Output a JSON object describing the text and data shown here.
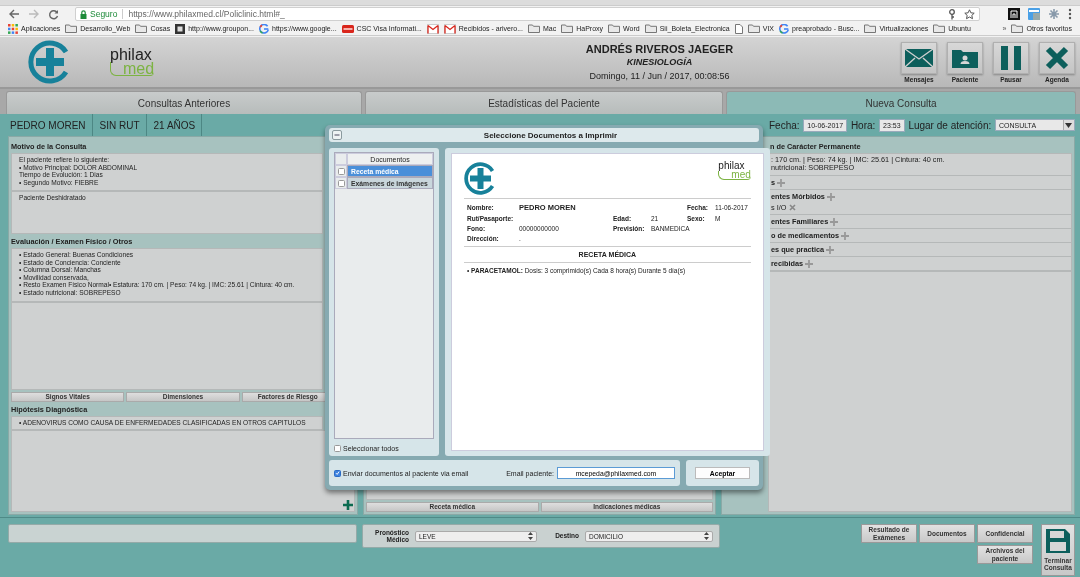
{
  "browser": {
    "secure_label": "Seguro",
    "url": "https://www.philaxmed.cl/Policlinic.html#_",
    "bookmarks": [
      {
        "kind": "apps",
        "label": "Aplicaciones"
      },
      {
        "kind": "folder",
        "label": "Desarrollo_Web"
      },
      {
        "kind": "folder",
        "label": "Cosas"
      },
      {
        "kind": "site",
        "label": "http://www.groupon..."
      },
      {
        "kind": "google",
        "label": "https://www.google..."
      },
      {
        "kind": "card",
        "label": "CSC Visa Informati..."
      },
      {
        "kind": "mail"
      },
      {
        "kind": "mail",
        "label": "Recibidos - arivero..."
      },
      {
        "kind": "folder",
        "label": "Mac"
      },
      {
        "kind": "folder",
        "label": "HaProxy"
      },
      {
        "kind": "folder",
        "label": "Word"
      },
      {
        "kind": "folder",
        "label": "Sii_Boleta_Electronica"
      },
      {
        "kind": "page"
      },
      {
        "kind": "folder",
        "label": "VIX"
      },
      {
        "kind": "google",
        "label": "preaprobado - Busc..."
      },
      {
        "kind": "folder",
        "label": "Virtualizaciones"
      },
      {
        "kind": "folder",
        "label": "Ubuntu"
      }
    ],
    "overflow": "»",
    "other": {
      "kind": "folder",
      "label": "Otros favoritos"
    }
  },
  "header": {
    "logo": {
      "word": "philax",
      "sub": "med"
    },
    "doctor": "ANDRÉS RIVEROS JAEGER",
    "specialty": "KINESIOLOGÍA",
    "datetime": "Domingo, 11 / Jun / 2017, 00:08:56",
    "buttons": [
      {
        "kind": "envelope",
        "label": "Mensajes"
      },
      {
        "kind": "folder-person",
        "label": "Paciente"
      },
      {
        "kind": "pause",
        "label": "Pausar"
      },
      {
        "kind": "close",
        "label": "Agenda"
      }
    ]
  },
  "tabs": [
    {
      "label": "Consultas Anteriores",
      "selected": false
    },
    {
      "label": "Estadísticas del Paciente",
      "selected": false
    },
    {
      "label": "Nueva Consulta",
      "selected": true
    }
  ],
  "patient_bar": {
    "name": "PEDRO MOREN",
    "rut": "SIN RUT",
    "age": "21 AÑOS",
    "date_label": "Fecha:",
    "date": "10-06-2017",
    "time_label": "Hora:",
    "time": "23:53",
    "place_label": "Lugar de atención:",
    "place": "CONSULTA"
  },
  "left_panel": {
    "motivo": {
      "title": "Motivo de la Consulta",
      "lines": [
        "El paciente refiere lo siguiente:",
        "• Motivo Principal: DOLOR ABDOMINAL",
        "Tiempo de Evolución: 1 Dias",
        "• Segundo Motivo: FIEBRE"
      ],
      "note": "Paciente Deshidratado"
    },
    "evaluacion": {
      "title": "Evaluación / Examen Físico / Otros",
      "lines": [
        "• Estado General: Buenas Condiciones",
        "• Estado de Conciencia: Conciente",
        "• Columna Dorsal: Manchas",
        "• Movilidad conservada,",
        "• Resto Examen Físico Normal• Estatura: 170 cm. | Peso: 74 kg. | IMC: 25.61 | Cintura: 40 cm.",
        "• Estado nutricional: SOBREPESO"
      ]
    },
    "buttons": [
      "Signos Vitales",
      "Dimensiones",
      "Factores de Riesgo"
    ],
    "hipotesis": {
      "title": "Hipótesis Diagnóstica",
      "lines": [
        "• ADENOVIRUS COMO CAUSA DE ENFERMEDADES CLASIFICADAS EN OTROS CAPITULOS"
      ]
    }
  },
  "middle_panel": {
    "tabs": [
      "Receta médica",
      "Indicaciones médicas"
    ]
  },
  "right_panel": {
    "title": "n de Carácter Permanente",
    "summary": [
      ": 170 cm. | Peso: 74 kg. | IMC: 25.61 | Cintura: 40 cm.",
      "nutricional: SOBREPESO"
    ],
    "groups": [
      {
        "label": "s"
      },
      {
        "label": "entes Mórbidos",
        "items": [
          "s I/O"
        ]
      },
      {
        "label": "entes Familiares"
      },
      {
        "label": "o de medicamentos"
      },
      {
        "label": "es que practica"
      },
      {
        "label": "recibidas"
      }
    ]
  },
  "bottom_bar": {
    "prognosis": {
      "label": "Pronóstico Médico",
      "value": "LEVE"
    },
    "destination": {
      "label": "Destino",
      "value": "DOMICILIO"
    },
    "actions": [
      "Resultado de Exámenes",
      "Documentos",
      "Confidencial",
      "Archivos del paciente"
    ],
    "finish": "Terminar Consulta"
  },
  "modal": {
    "title": "Seleccione Documentos a Imprimir",
    "list_header": "Documentos",
    "documents": [
      {
        "label": "Receta médica",
        "selected": true,
        "checked": false
      },
      {
        "label": "Exámenes de imágenes",
        "selected": false,
        "checked": false
      }
    ],
    "select_all": {
      "label": "Seleccionar todos",
      "checked": false
    },
    "preview": {
      "logo": {
        "word": "philax",
        "sub": "med"
      },
      "rows": [
        [
          "Nombre:",
          "PEDRO MOREN",
          "",
          "",
          "Fecha:",
          "11-06-2017"
        ],
        [
          "Rut/Pasaporte:",
          "",
          "Edad:",
          "21",
          "Sexo:",
          "M"
        ],
        [
          "Fono:",
          "00000000000",
          "Previsión:",
          "BANMEDICA"
        ],
        [
          "Dirección:",
          "."
        ]
      ],
      "section_title": "RECETA MÉDICA",
      "items": [
        "• **PARACETAMOL:** Dosis: 3 comprimido(s) Cada 8 hora(s) Durante 5 día(s)"
      ]
    },
    "send_email": {
      "label": "Enviar documentos al paciente via email",
      "checked": true
    },
    "email_label": "Email paciente:",
    "email": "mcepeda@philaxmed.com",
    "accept": "Aceptar"
  }
}
